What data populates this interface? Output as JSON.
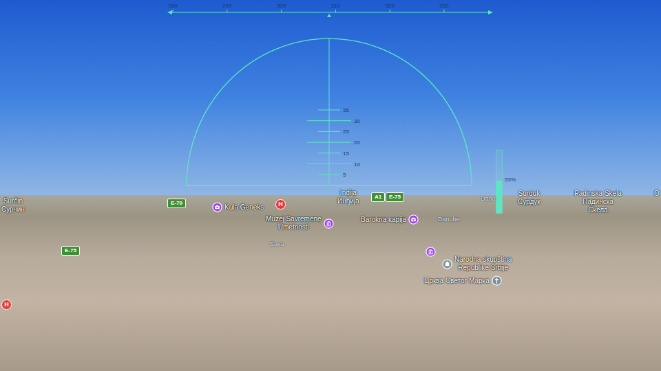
{
  "heading_tape": {
    "ticks": [
      "280",
      "290",
      "300",
      "310",
      "320",
      "330"
    ]
  },
  "pitch_ladder": {
    "ticks": [
      "35",
      "30",
      "25",
      "20",
      "15",
      "10",
      "5"
    ]
  },
  "throttle": {
    "level": 0.5,
    "reading": "53%"
  },
  "map_labels": [
    {
      "lines": [
        "Surčin",
        "Сурчин"
      ],
      "kind": "place"
    },
    {
      "lines": [
        "Kula Geneks"
      ],
      "kind": "camera"
    },
    {
      "lines": [
        "H"
      ],
      "kind": "hospital"
    },
    {
      "lines": [
        "Inđija",
        "Инђија"
      ],
      "kind": "place"
    },
    {
      "lines": [
        "Muzej Savremene",
        "Umetnosti"
      ],
      "kind": "museum"
    },
    {
      "lines": [
        "Barokna kapija"
      ],
      "kind": "camera"
    },
    {
      "lines": [
        "Danu"
      ],
      "kind": "river"
    },
    {
      "lines": [
        "Danube"
      ],
      "kind": "river"
    },
    {
      "lines": [
        "Sava"
      ],
      "kind": "river"
    },
    {
      "lines": [],
      "kind": "museum"
    },
    {
      "lines": [
        "Narodna skupština",
        "Republike Srbije"
      ],
      "kind": "landmark"
    },
    {
      "lines": [
        "Црква Светог Марка"
      ],
      "kind": "church"
    },
    {
      "lines": [
        "H"
      ],
      "kind": "hospital"
    },
    {
      "lines": [
        "Surduk",
        "Сурдук"
      ],
      "kind": "place"
    },
    {
      "lines": [
        "Padinska Skela",
        "Падинска",
        "Скела"
      ],
      "kind": "place"
    },
    {
      "lines": [
        "O"
      ],
      "kind": "place"
    }
  ],
  "road_shields": [
    {
      "text": "E-70"
    },
    {
      "text": "A1"
    },
    {
      "text": "E-75"
    },
    {
      "text": "E-75"
    }
  ]
}
